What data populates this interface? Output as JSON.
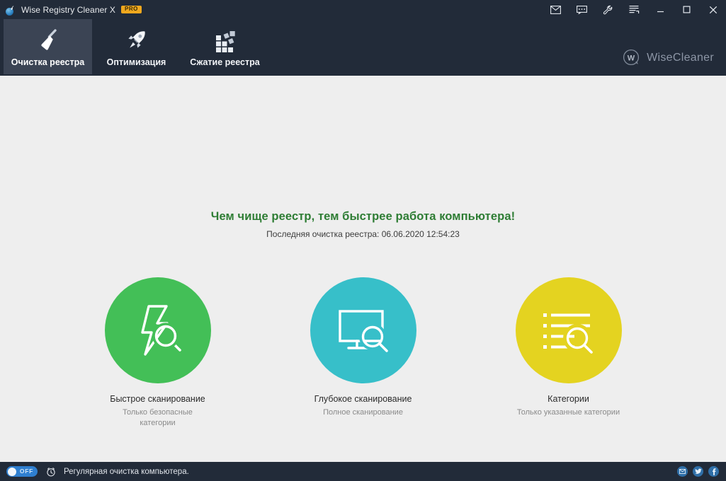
{
  "window": {
    "title": "Wise Registry Cleaner X",
    "badge": "PRO",
    "app_icon": "broom-sphere-icon",
    "controls": [
      {
        "name": "mail-icon",
        "tip": "Почта"
      },
      {
        "name": "feedback-icon",
        "tip": "Отзыв"
      },
      {
        "name": "wrench-icon",
        "tip": "Инструменты"
      },
      {
        "name": "menu-icon",
        "tip": "Меню"
      },
      {
        "name": "minimize-icon",
        "tip": "Свернуть"
      },
      {
        "name": "maximize-icon",
        "tip": "Развернуть"
      },
      {
        "name": "close-icon",
        "tip": "Закрыть"
      }
    ]
  },
  "tabs": [
    {
      "label": "Очистка реестра",
      "icon": "broom-icon",
      "active": true
    },
    {
      "label": "Оптимизация",
      "icon": "rocket-icon",
      "active": false
    },
    {
      "label": "Сжатие реестра",
      "icon": "blocks-icon",
      "active": false
    }
  ],
  "brand": {
    "name": "WiseCleaner",
    "mark": "w-logo-icon"
  },
  "main": {
    "headline": "Чем чище реестр, тем быстрее работа компьютера!",
    "last_clean": "Последняя очистка реестра: 06.06.2020 12:54:23",
    "options": [
      {
        "title": "Быстрое сканирование",
        "subtitle": "Только безопасные категории",
        "icon": "lightning-search-icon",
        "color": "#43bf57"
      },
      {
        "title": "Глубокое сканирование",
        "subtitle": "Полное сканирование",
        "icon": "monitor-search-icon",
        "color": "#37bfc9"
      },
      {
        "title": "Категории",
        "subtitle": "Только указанные категории",
        "icon": "list-search-icon",
        "color": "#e4d320"
      }
    ]
  },
  "statusbar": {
    "toggle_state": "OFF",
    "schedule_icon": "alarm-clock-icon",
    "text": "Регулярная очистка компьютера.",
    "socials": [
      {
        "name": "email-social-icon"
      },
      {
        "name": "twitter-social-icon"
      },
      {
        "name": "facebook-social-icon"
      }
    ]
  },
  "colors": {
    "chrome": "#222b39",
    "tab_active": "#3b4454",
    "content_bg": "#eeeeee",
    "headline_green": "#2e7d34",
    "accent_blue": "#2f7fd0",
    "badge_orange": "#f0a81e"
  }
}
